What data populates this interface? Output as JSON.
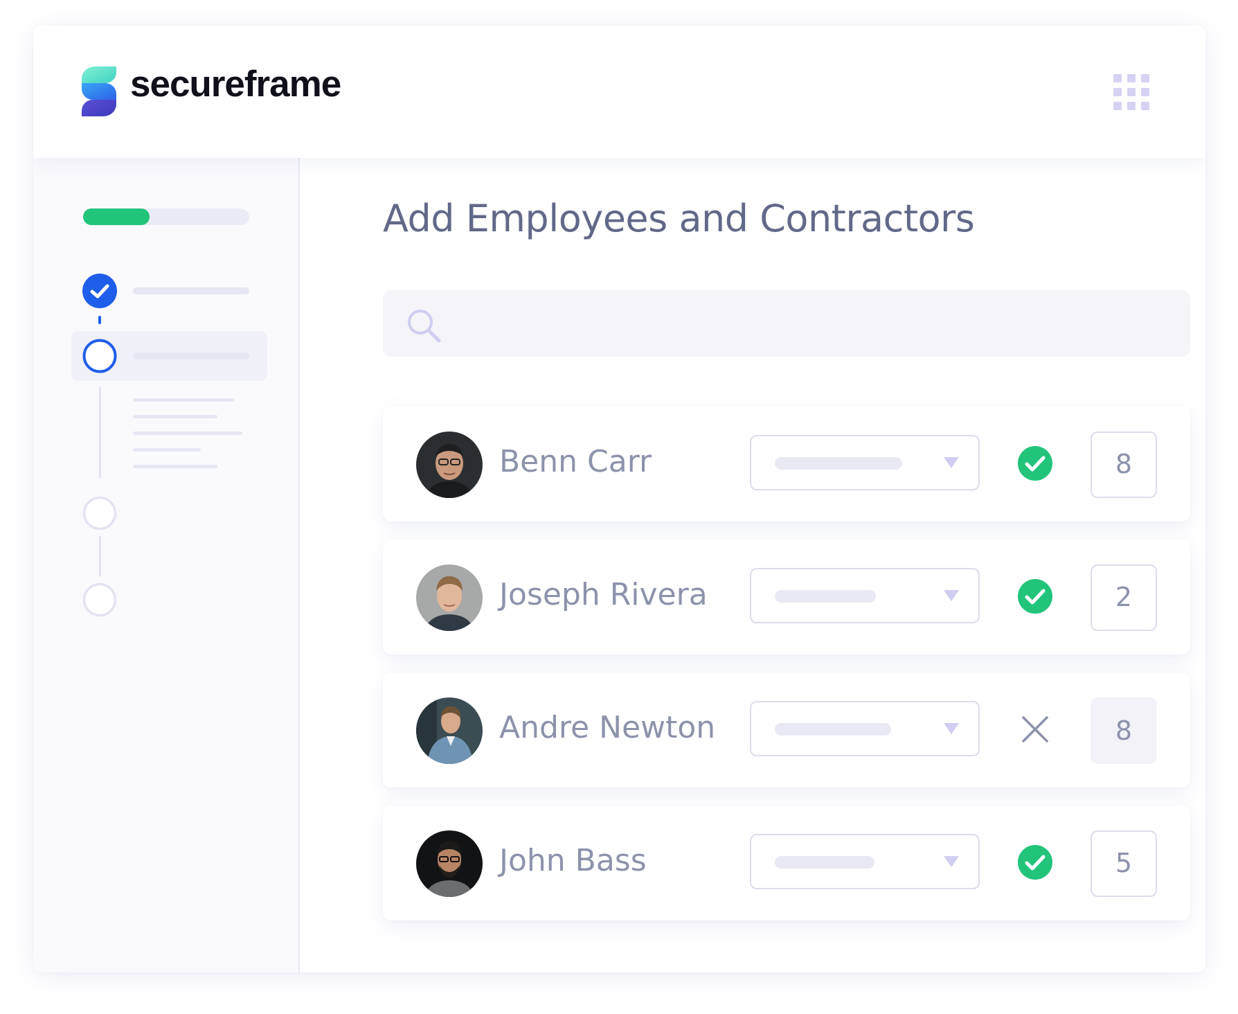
{
  "header": {
    "brand_name": "secureframe",
    "logo_icon": "secureframe-logo-icon",
    "apps_icon": "grid-icon"
  },
  "sidebar": {
    "progress": 0.4,
    "progress_color": "#22c47a",
    "steps": [
      {
        "state": "completed",
        "icon": "check-circle-icon"
      },
      {
        "state": "active",
        "icon": "circle-outline-icon"
      },
      {
        "state": "pending",
        "icon": "circle-outline-icon"
      },
      {
        "state": "pending",
        "icon": "circle-outline-icon"
      }
    ]
  },
  "main": {
    "title": "Add Employees and Contractors",
    "search": {
      "placeholder": "",
      "value": "",
      "icon": "search-icon"
    },
    "people": [
      {
        "name": "Benn Carr",
        "status": "complete",
        "status_icon": "check-circle-icon",
        "count": "8"
      },
      {
        "name": "Joseph Rivera",
        "status": "complete",
        "status_icon": "check-circle-icon",
        "count": "2"
      },
      {
        "name": "Andre Newton",
        "status": "incomplete",
        "status_icon": "close-icon",
        "count": "8"
      },
      {
        "name": "John Bass",
        "status": "complete",
        "status_icon": "check-circle-icon",
        "count": "5"
      }
    ]
  },
  "colors": {
    "accent_blue": "#1f5eea",
    "success_green": "#22c47a",
    "title_text": "#626888",
    "name_text": "#8c92ab",
    "muted_lavender": "#cfcdf0"
  }
}
